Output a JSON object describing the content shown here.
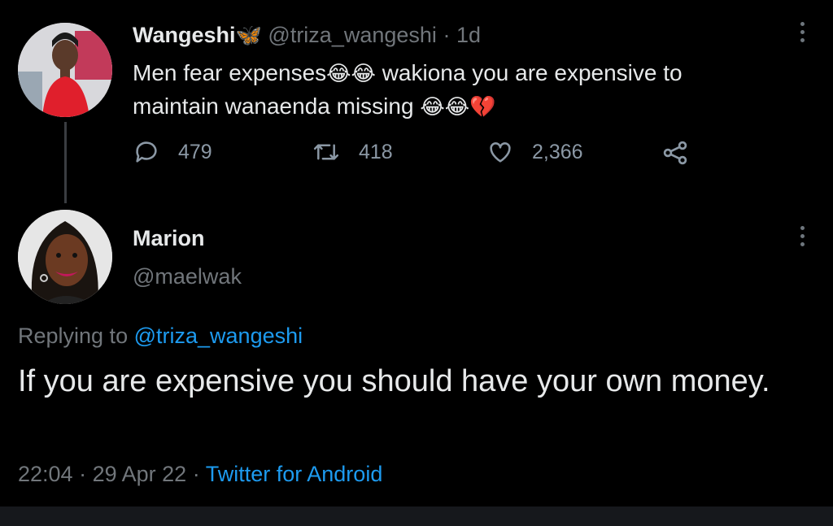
{
  "original_tweet": {
    "display_name": "Wangeshi",
    "badge_emoji": "🦋",
    "handle": "@triza_wangeshi",
    "separator": "·",
    "time_ago": "1d",
    "text_line1_a": "Men fear expenses",
    "text_line1_emoji": "😂😂",
    "text_line1_b": "wakiona you are expensive to",
    "text_line2": "maintain wanaenda missing",
    "text_line2_emoji": "😂😂💔",
    "replies": "479",
    "retweets": "418",
    "likes": "2,366"
  },
  "reply_tweet": {
    "display_name": "Marion",
    "handle": "@maelwak",
    "replying_to_label": "Replying to",
    "replying_to_handle": "@triza_wangeshi",
    "text": "If you are expensive you should have your own money.",
    "time": "22:04",
    "date": "29 Apr 22",
    "separator": "·",
    "source": "Twitter for Android"
  },
  "icons": {
    "reply": "reply-icon",
    "retweet": "retweet-icon",
    "like": "heart-icon",
    "share": "share-icon",
    "more": "more-options-icon"
  },
  "colors": {
    "background": "#000000",
    "text": "#e7e9ea",
    "muted": "#71767b",
    "accent": "#1d9bf0",
    "heart_emoji": "#e0245e"
  }
}
